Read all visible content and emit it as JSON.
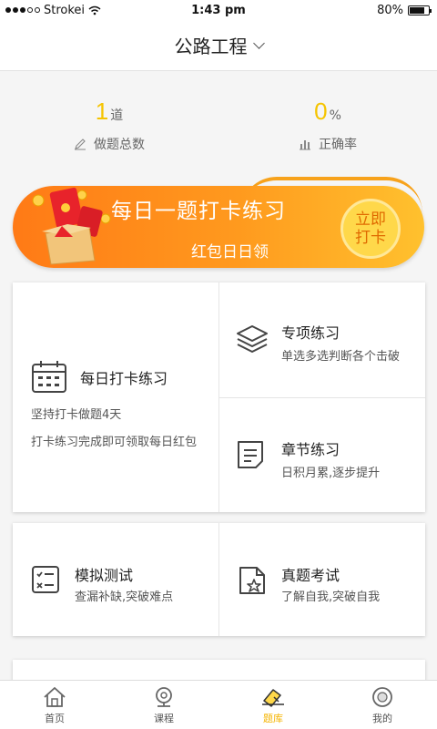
{
  "status_bar": {
    "carrier": "Strokei",
    "time": "1:43 pm",
    "battery": "80%"
  },
  "header": {
    "title": "公路工程"
  },
  "stats": {
    "questions_done": {
      "value": "1",
      "unit": "道",
      "label": "做题总数",
      "icon": "pencil-icon"
    },
    "accuracy": {
      "value": "0",
      "unit": "%",
      "label": "正确率",
      "icon": "bar-chart-icon"
    }
  },
  "banner": {
    "title": "每日一题打卡练习",
    "subtitle": "红包日日领",
    "button_line1": "立即",
    "button_line2": "打卡"
  },
  "practice": {
    "daily": {
      "title": "每日打卡练习",
      "desc1": "坚持打卡做题4天",
      "desc2": "打卡练习完成即可领取每日红包",
      "icon": "calendar-icon"
    },
    "special": {
      "title": "专项练习",
      "desc": "单选多选判断各个击破",
      "icon": "layers-icon"
    },
    "chapter": {
      "title": "章节练习",
      "desc": "日积月累,逐步提升",
      "icon": "document-icon"
    }
  },
  "exams": {
    "mock": {
      "title": "模拟测试",
      "desc": "查漏补缺,突破难点",
      "icon": "checklist-icon"
    },
    "real": {
      "title": "真题考试",
      "desc": "了解自我,突破自我",
      "icon": "star-document-icon"
    }
  },
  "tabbar": {
    "tabs": [
      {
        "label": "首页",
        "icon": "home-icon",
        "active": false
      },
      {
        "label": "课程",
        "icon": "camera-icon",
        "active": false
      },
      {
        "label": "题库",
        "icon": "question-bank-icon",
        "active": true
      },
      {
        "label": "我的",
        "icon": "profile-icon",
        "active": false
      }
    ]
  },
  "colors": {
    "accent": "#f5c400",
    "banner_start": "#ff7a16",
    "banner_end": "#ffc12e"
  }
}
